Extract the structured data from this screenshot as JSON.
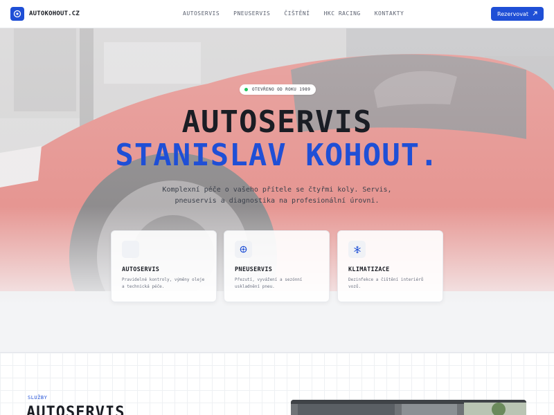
{
  "header": {
    "logo_text": "AUTOKOHOUT.CZ",
    "nav": [
      "AUTOSERVIS",
      "PNEUSERVIS",
      "ČIŠTĚNÍ",
      "HKC RACING",
      "KONTAKTY"
    ],
    "cta_label": "Rezervovat",
    "cta_icon": "arrow-up-right-icon"
  },
  "hero": {
    "badge": "OTEVŘENO OD ROKU 1989",
    "title_line1": "AUTOSERVIS",
    "title_line2": "STANISLAV KOHOUT.",
    "subtitle": "Komplexní péče o vašeho přítele se čtyřmi koly. Servis, pneuservis a diagnostika na profesionální úrovni.",
    "cards": [
      {
        "title": "AUTOSERVIS",
        "desc": "Pravidelné kontroly, výměny oleje a technická péče.",
        "icon": "wrench-icon"
      },
      {
        "title": "PNEUSERVIS",
        "desc": "Přezutí, vyvážení a sezónní uskladnění pneu.",
        "icon": "tire-icon"
      },
      {
        "title": "KLIMATIZACE",
        "desc": "Dezinfekce a čištění interiérů vozů.",
        "icon": "snowflake-icon"
      }
    ]
  },
  "services": {
    "label": "SLUŽBY",
    "title": "AUTOSERVIS"
  },
  "colors": {
    "accent": "#1f4fd6",
    "badge_dot": "#22c55e",
    "car_red": "#d9463d"
  }
}
